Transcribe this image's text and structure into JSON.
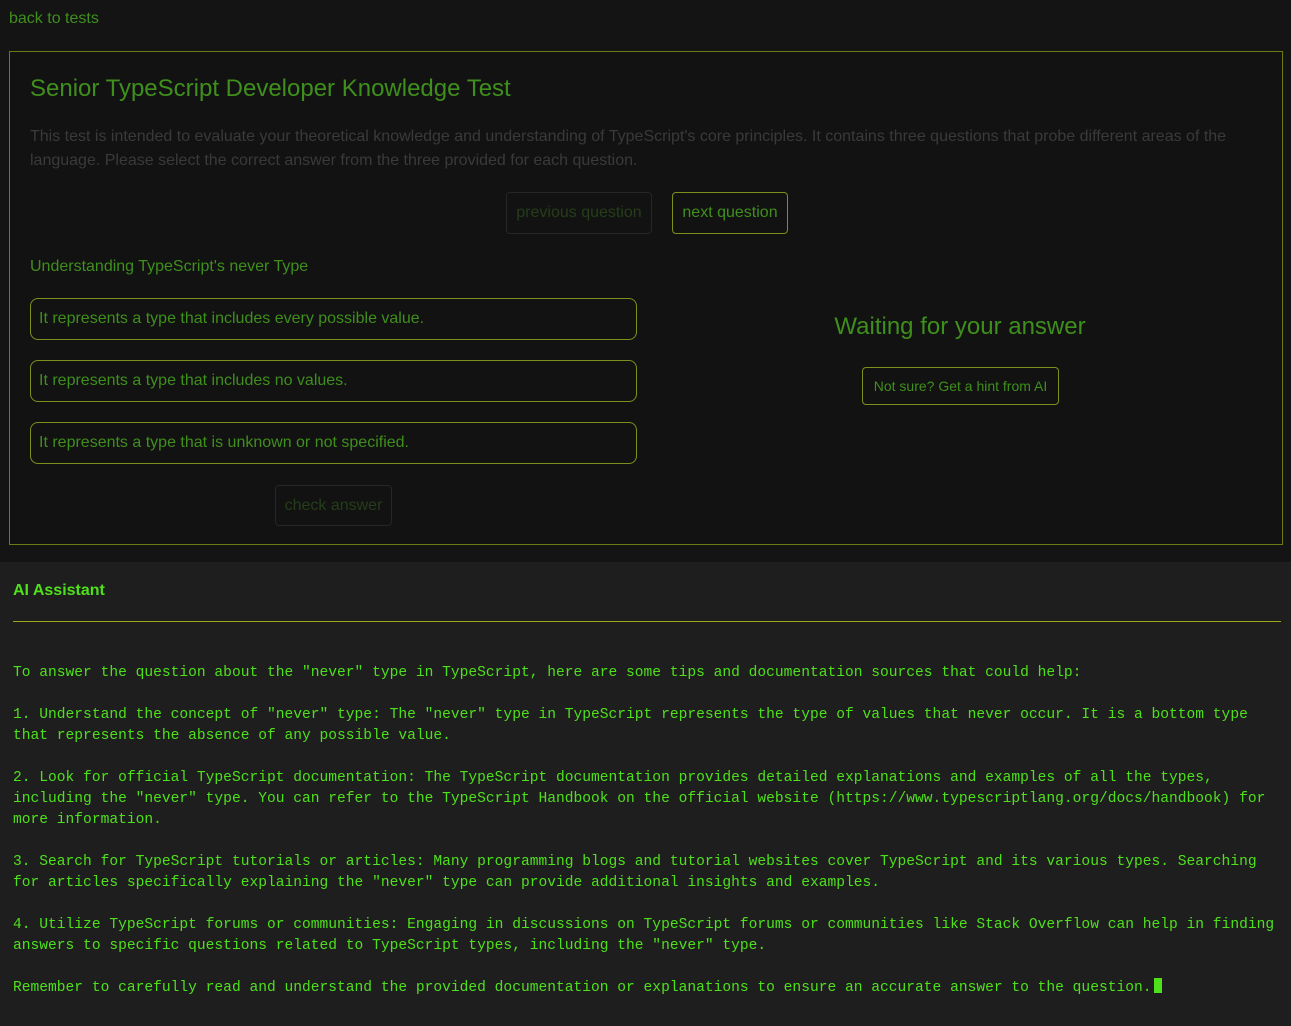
{
  "nav": {
    "back_label": "back to tests"
  },
  "test": {
    "title": "Senior TypeScript Developer Knowledge Test",
    "description": "This test is intended to evaluate your theoretical knowledge and understanding of TypeScript's core principles. It contains three questions that probe different areas of the language. Please select the correct answer from the three provided for each question.",
    "prev_label": "previous question",
    "next_label": "next question",
    "question": {
      "title": "Understanding TypeScript's never Type",
      "options": [
        "It represents a type that includes every possible value.",
        "It represents a type that includes no values.",
        "It represents a type that is unknown or not specified."
      ]
    },
    "check_label": "check answer",
    "status_text": "Waiting for your answer",
    "hint_label": "Not sure? Get a hint from AI"
  },
  "assistant": {
    "title": "AI Assistant",
    "paragraphs": [
      "To answer the question about the \"never\" type in TypeScript, here are some tips and documentation sources that could help:",
      "1. Understand the concept of \"never\" type: The \"never\" type in TypeScript represents the type of values that never occur. It is a bottom type that represents the absence of any possible value.",
      "2. Look for official TypeScript documentation: The TypeScript documentation provides detailed explanations and examples of all the types, including the \"never\" type. You can refer to the TypeScript Handbook on the official website (https://www.typescriptlang.org/docs/handbook) for more information.",
      "3. Search for TypeScript tutorials or articles: Many programming blogs and tutorial websites cover TypeScript and its various types. Searching for articles specifically explaining the \"never\" type can provide additional insights and examples.",
      "4. Utilize TypeScript forums or communities: Engaging in discussions on TypeScript forums or communities like Stack Overflow can help in finding answers to specific questions related to TypeScript types, including the \"never\" type.",
      "Remember to carefully read and understand the provided documentation or explanations to ensure an accurate answer to the question."
    ]
  },
  "colors": {
    "background": "#141414",
    "accent_green": "#3f8f1c",
    "bright_green": "#4fe01c",
    "border_olive": "#7f8f1a",
    "assistant_bg": "#1e1e1e"
  }
}
